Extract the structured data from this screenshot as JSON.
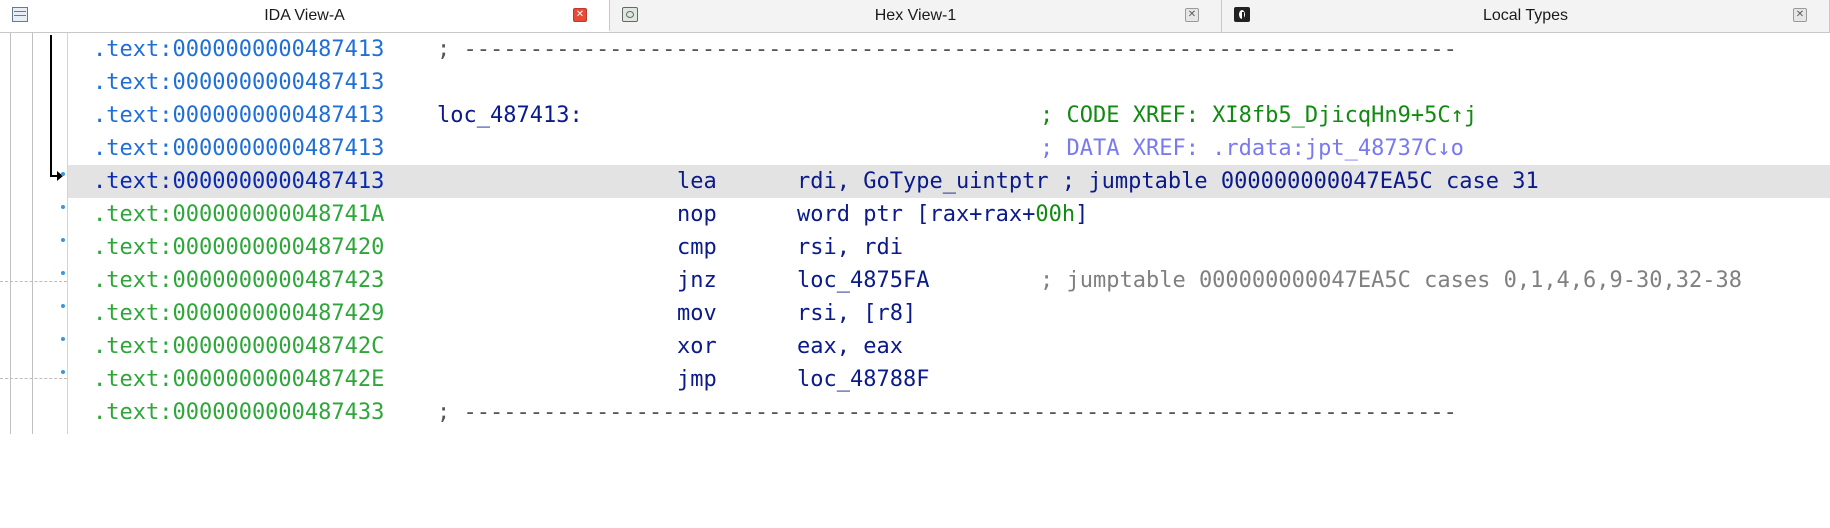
{
  "tabs": [
    {
      "label": "IDA View-A",
      "icon": "disassembly-view-icon",
      "active": true,
      "close": "✕"
    },
    {
      "label": "Hex View-1",
      "icon": "hex-view-icon",
      "active": false,
      "close": "✕"
    },
    {
      "label": "Local Types",
      "icon": "local-types-icon",
      "active": false,
      "close": "✕"
    }
  ],
  "listing": {
    "rows": [
      {
        "addr": ".text:0000000000487413",
        "sep": "; ---------------------------------------------------------------------------"
      },
      {
        "addr": ".text:0000000000487413"
      },
      {
        "addr": ".text:0000000000487413",
        "label": "loc_487413:",
        "comment": "; CODE XREF: XI8fb5_DjicqHn9+5C↑j"
      },
      {
        "addr": ".text:0000000000487413",
        "comment": "; DATA XREF: .rdata:jpt_48737C↓o"
      },
      {
        "addr": ".text:0000000000487413",
        "mnemonic": "lea",
        "operands": "rdi, GoType_uintptr",
        "inline_comment": " ; jumptable 000000000047EA5C case 31"
      },
      {
        "addr": ".text:000000000048741A",
        "mnemonic": "nop",
        "operands_prefix": "word ptr [rax+rax+",
        "operands_num": "00h",
        "operands_suffix": "]"
      },
      {
        "addr": ".text:0000000000487420",
        "mnemonic": "cmp",
        "operands": "rsi, rdi"
      },
      {
        "addr": ".text:0000000000487423",
        "mnemonic": "jnz",
        "operands": "loc_4875FA",
        "comment": "; jumptable 000000000047EA5C cases 0,1,4,6,9-30,32-38"
      },
      {
        "addr": ".text:0000000000487429",
        "mnemonic": "mov",
        "operands": "rsi, [r8]"
      },
      {
        "addr": ".text:000000000048742C",
        "mnemonic": "xor",
        "operands": "eax, eax"
      },
      {
        "addr": ".text:000000000048742E",
        "mnemonic": "jmp",
        "operands": "loc_48788F"
      },
      {
        "addr": ".text:0000000000487433",
        "sep": "; ---------------------------------------------------------------------------"
      }
    ]
  },
  "colors": {
    "segment_address": "#1f6fd6",
    "code_address": "#2ea63a",
    "instruction": "#0a1a8a",
    "code_xref": "#118a11",
    "data_xref": "#7a7af0",
    "auto_comment": "#808080",
    "highlight_row": "#e3e3e3",
    "close_active": "#e84a3a"
  }
}
